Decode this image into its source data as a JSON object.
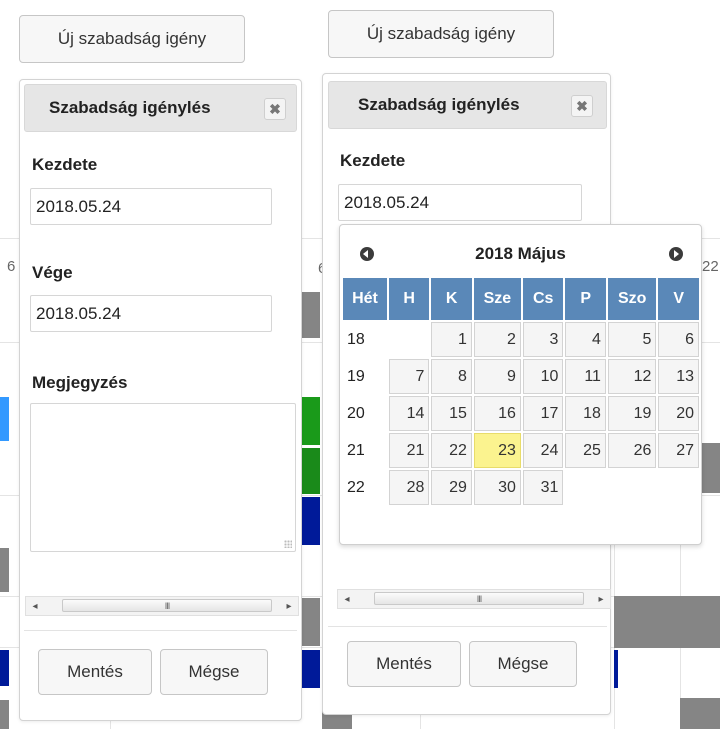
{
  "new_request_button": "Új szabadság igény",
  "dialog": {
    "title": "Szabadság igénylés",
    "close_symbol": "✖",
    "start_label": "Kezdete",
    "start_value": "2018.05.24",
    "end_label": "Vége",
    "end_value": "2018.05.24",
    "note_label": "Megjegyzés",
    "note_value": "",
    "scroll_left": "◂",
    "scroll_right": "▸",
    "scroll_grip": "III",
    "save_button": "Mentés",
    "cancel_button": "Mégse"
  },
  "datepicker": {
    "month_title": "2018 Május",
    "headers": [
      "Hét",
      "H",
      "K",
      "Sze",
      "Cs",
      "P",
      "Szo",
      "V"
    ],
    "weeks": [
      {
        "week": "18",
        "days": [
          "",
          "1",
          "2",
          "3",
          "4",
          "5",
          "6"
        ]
      },
      {
        "week": "19",
        "days": [
          "7",
          "8",
          "9",
          "10",
          "11",
          "12",
          "13"
        ]
      },
      {
        "week": "20",
        "days": [
          "14",
          "15",
          "16",
          "17",
          "18",
          "19",
          "20"
        ]
      },
      {
        "week": "21",
        "days": [
          "21",
          "22",
          "23",
          "24",
          "25",
          "26",
          "27"
        ]
      },
      {
        "week": "22",
        "days": [
          "28",
          "29",
          "30",
          "31",
          "",
          "",
          ""
        ]
      }
    ],
    "selected_day": "23",
    "selected_color": "#fbf38f"
  },
  "background": {
    "fragment_left": "6",
    "fragment_mid": "6",
    "fragment_right": "22"
  },
  "colors": {
    "header_blue": "#5a88b8",
    "event_gray": "#858585",
    "event_blue": "#3399ff",
    "event_green": "#1a9a1a",
    "event_navy": "#001a99"
  }
}
